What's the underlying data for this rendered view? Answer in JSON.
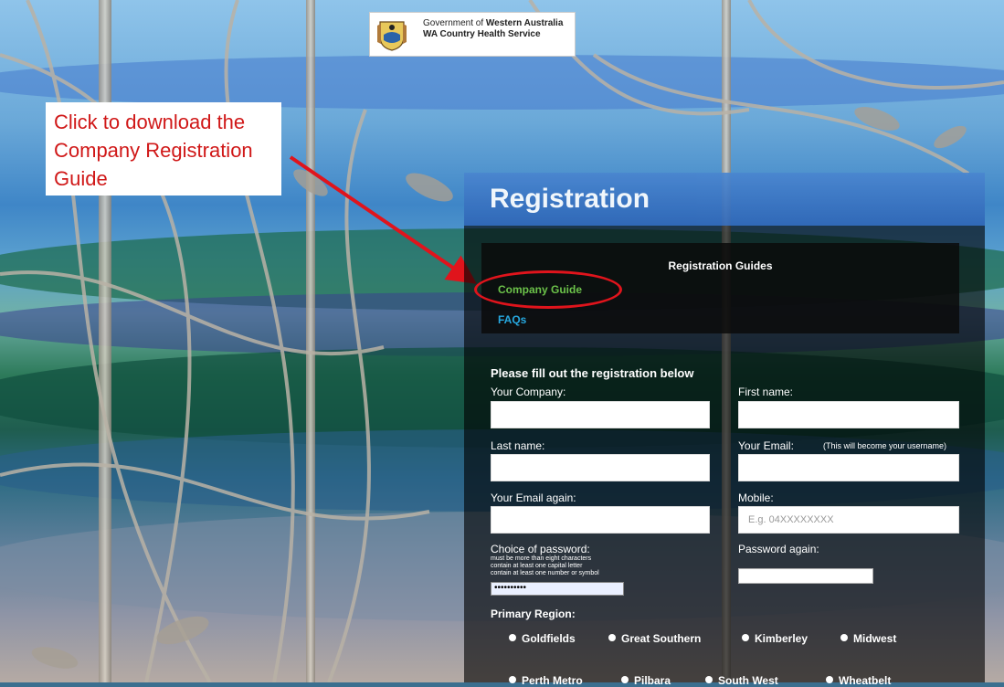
{
  "header": {
    "gov_prefix": "Government of ",
    "gov_bold": "Western Australia",
    "service": "WA Country Health Service"
  },
  "callout": {
    "text": "Click to download the Company Registration Guide",
    "color": "#d01818"
  },
  "registration": {
    "title": "Registration",
    "guides_title": "Registration Guides",
    "company_guide": "Company Guide",
    "faqs": "FAQs"
  },
  "form": {
    "title": "Please fill out the registration below",
    "company_label": "Your Company:",
    "first_name_label": "First name:",
    "last_name_label": "Last name:",
    "email_label": "Your Email:",
    "email_note": "(This will become your username)",
    "email_again_label": "Your Email again:",
    "mobile_label": "Mobile:",
    "mobile_placeholder": "E.g. 04XXXXXXXX",
    "password_label": "Choice of password:",
    "password_rule_1": "must be more than eight characters",
    "password_rule_2": "contain at least one capital letter",
    "password_rule_3": "contain at least one number or symbol",
    "password_value": "••••••••••",
    "password_again_label": "Password again:",
    "region_label": "Primary Region:",
    "regions": [
      "Goldfields",
      "Great Southern",
      "Kimberley",
      "Midwest",
      "Perth Metro",
      "Pilbara",
      "South West",
      "Wheatbelt"
    ]
  },
  "colors": {
    "header_blue": "#2f66b6",
    "company_guide_green": "#6cc24a",
    "faqs_blue": "#27a8e0",
    "annotation_red": "#e0141c"
  }
}
